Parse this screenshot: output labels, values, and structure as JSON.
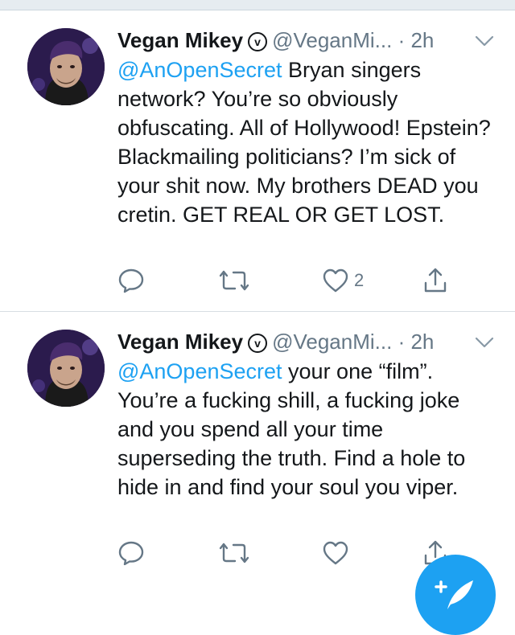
{
  "colors": {
    "accent": "#1da1f2",
    "muted": "#657786",
    "text": "#14171a",
    "divider": "#d8dee2"
  },
  "tweets": [
    {
      "author": "Vegan Mikey",
      "verified_glyph": "v",
      "handle": "@VeganMi...",
      "separator": "·",
      "time": "2h",
      "mention": "@AnOpenSecret",
      "text": " Bryan singers network? You’re so obviously obfuscating. All of Hollywood! Epstein? Blackmailing politicians? I’m sick of your shit now. My brothers DEAD you cretin. GET REAL OR GET LOST.",
      "like_count": "2",
      "icons": [
        "reply-icon",
        "retweet-icon",
        "heart-icon",
        "share-icon"
      ]
    },
    {
      "author": "Vegan Mikey",
      "verified_glyph": "v",
      "handle": "@VeganMi...",
      "separator": "·",
      "time": "2h",
      "mention": "@AnOpenSecret",
      "text": " your one “film”. You’re a fucking shill, a fucking joke and you spend all your time superseding the truth. Find a hole to hide in and find your soul you viper.",
      "like_count": "",
      "icons": [
        "reply-icon",
        "retweet-icon",
        "heart-icon",
        "share-icon"
      ]
    }
  ],
  "fab": {
    "icon": "compose-tweet-icon"
  }
}
